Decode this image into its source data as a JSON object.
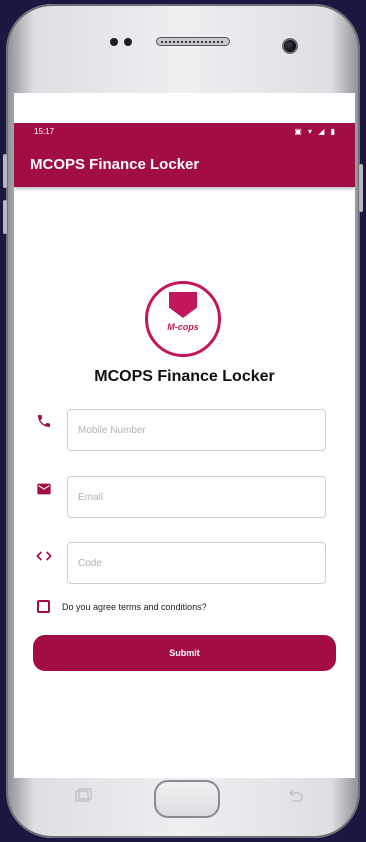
{
  "status_bar": {
    "time": "15:17",
    "icons": "▣ ▾ ◢ ▮"
  },
  "app_bar": {
    "title": "MCOPS Finance Locker"
  },
  "logo": {
    "text": "M-cops"
  },
  "app_title": "MCOPS Finance Locker",
  "form": {
    "mobile": {
      "placeholder": "Mobile Number",
      "value": ""
    },
    "email": {
      "placeholder": "Email",
      "value": ""
    },
    "code": {
      "placeholder": "Code",
      "value": ""
    },
    "terms_label": "Do you agree terms and conditions?",
    "terms_checked": false,
    "submit_label": "Submit"
  },
  "icons": {
    "mobile": "phone-icon",
    "email": "mail-icon",
    "code": "code-icon",
    "back": "back-icon",
    "recents": "recents-icon"
  },
  "colors": {
    "primary": "#a30d46",
    "accent": "#c2185b",
    "background": "#1a1840"
  }
}
